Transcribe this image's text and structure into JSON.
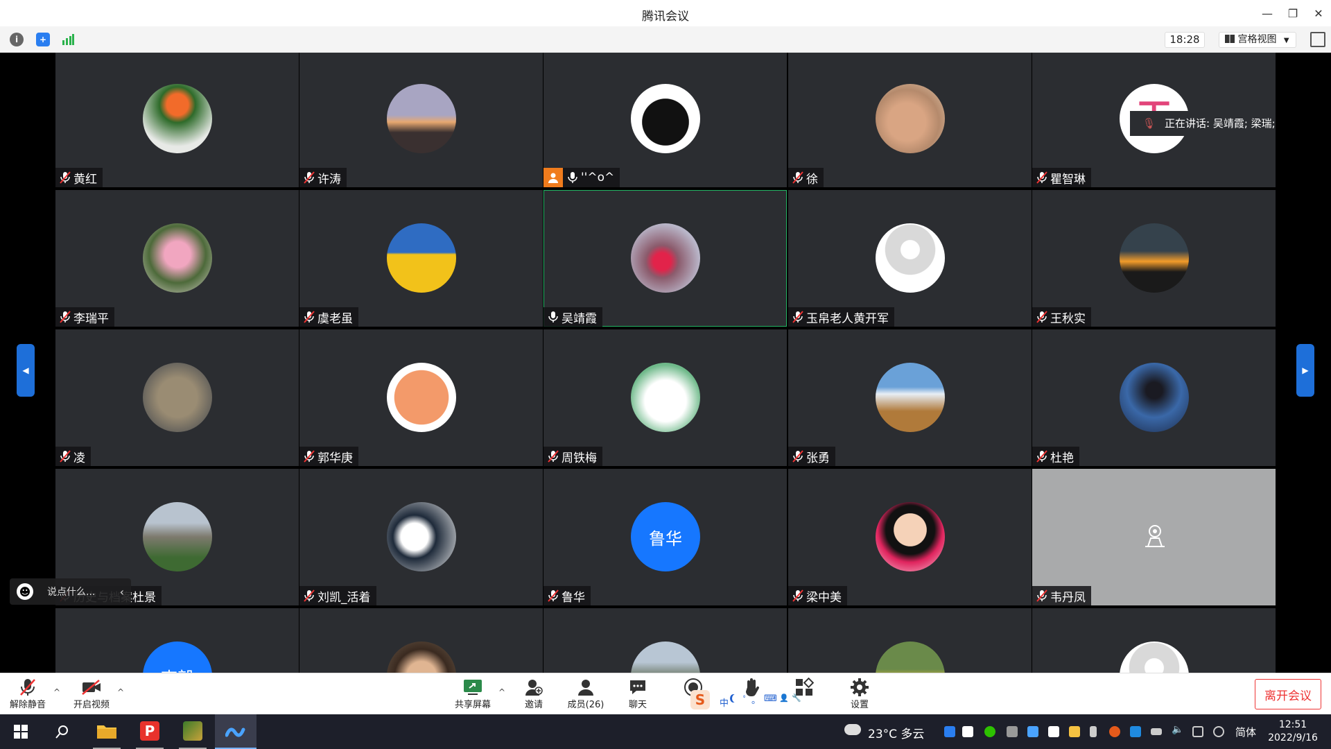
{
  "window": {
    "title": "腾讯会议"
  },
  "toolbar": {
    "clock": "18:28",
    "view_label": "宫格视图"
  },
  "speaking": {
    "label": "正在讲话: 吴靖霞; 梁瑞;"
  },
  "tiles": [
    {
      "name": "黄红",
      "avatar": "flower-red"
    },
    {
      "name": "许涛",
      "avatar": "sunset-people"
    },
    {
      "name": "''^o^",
      "avatar": "black-cat",
      "host": true
    },
    {
      "name": "徐",
      "avatar": "cat-photo"
    },
    {
      "name": "瞿智琳",
      "avatar": "pink-text"
    },
    {
      "name": "李瑞平",
      "avatar": "pink-flowers"
    },
    {
      "name": "虞老虽",
      "avatar": "yellow-field"
    },
    {
      "name": "吴靖霞",
      "avatar": "red-blossom",
      "active": true
    },
    {
      "name": "玉帛老人黄开军",
      "avatar": "default-person"
    },
    {
      "name": "王秋实",
      "avatar": "sunset-silhouette"
    },
    {
      "name": "凌",
      "avatar": "rock"
    },
    {
      "name": "郭华庚",
      "avatar": "orange-pig"
    },
    {
      "name": "周铁梅",
      "avatar": "white-rabbit"
    },
    {
      "name": "张勇",
      "avatar": "mountain-blue"
    },
    {
      "name": "杜艳",
      "avatar": "night-silhouette"
    },
    {
      "name": "历史与档案杜景",
      "avatar": "rock-garden"
    },
    {
      "name": "刘凯_活着",
      "avatar": "wedding"
    },
    {
      "name": "鲁华",
      "avatar": "text",
      "avatar_text": "鲁华"
    },
    {
      "name": "梁中美",
      "avatar": "cartoon-girl"
    },
    {
      "name": "韦丹凤",
      "avatar": "camera-off"
    },
    {
      "name": "",
      "avatar": "text",
      "avatar_text": "李毅"
    },
    {
      "name": "",
      "avatar": "young-man"
    },
    {
      "name": "",
      "avatar": "mountain-green"
    },
    {
      "name": "",
      "avatar": "rice-terrace"
    },
    {
      "name": "",
      "avatar": "default-person"
    }
  ],
  "chat": {
    "placeholder": "说点什么..."
  },
  "controls": {
    "unmute": "解除静音",
    "video": "开启视频",
    "share": "共享屏幕",
    "invite": "邀请",
    "members": "成员(26)",
    "chat": "聊天",
    "settings": "设置",
    "leave": "离开会议"
  },
  "ime": {
    "chars": [
      "中",
      "ﾟ",
      "。",
      "⌨",
      "👤",
      "🔧"
    ]
  },
  "taskbar": {
    "weather": "23°C 多云",
    "lang": "简体",
    "time": "12:51",
    "date": "2022/9/16"
  },
  "colors": {
    "accent": "#1677ff",
    "leave": "#e33333",
    "host": "#f07c1d",
    "active_border": "#23b564"
  }
}
